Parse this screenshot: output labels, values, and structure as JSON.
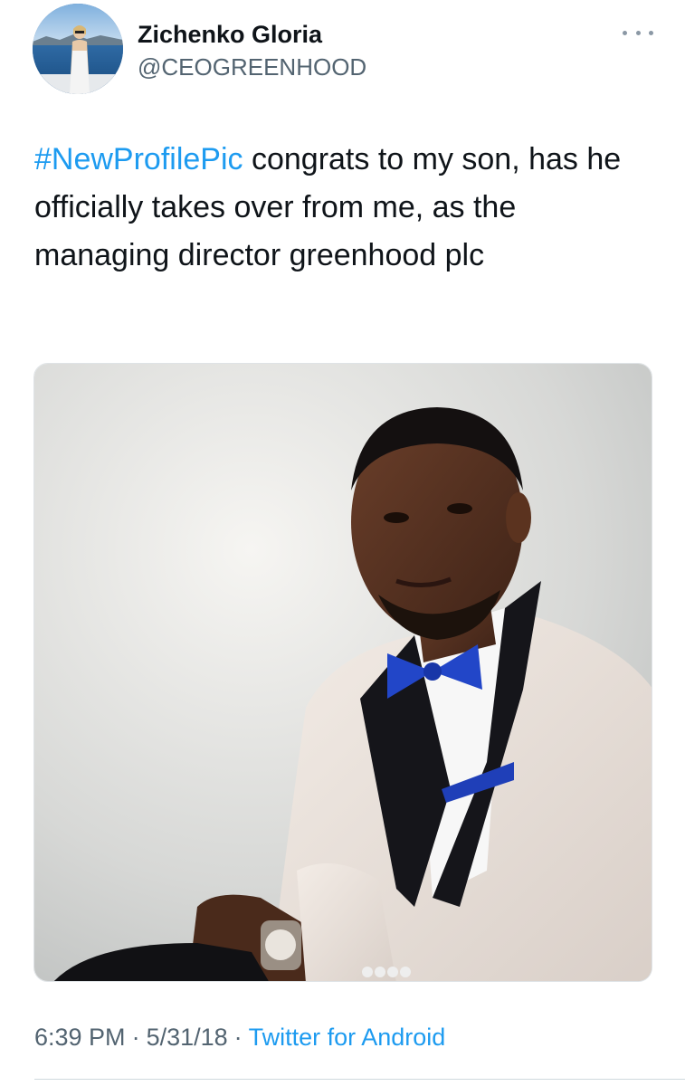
{
  "tweet": {
    "author": {
      "name": "Zichenko Gloria",
      "handle": "@CEOGREENHOOD",
      "avatar_icon": "profile-photo"
    },
    "more_icon": "more-options-icon",
    "hashtag": "#NewProfilePic",
    "text": " congrats to my son, has he officially takes over from me, as the managing director greenhood plc",
    "media": {
      "type": "photo"
    },
    "time": "6:39 PM",
    "separator": "·",
    "date": "5/31/18",
    "source": "Twitter for Android"
  },
  "colors": {
    "link": "#1d9bf0",
    "secondary_text": "#536471",
    "primary_text": "#0f1419"
  }
}
